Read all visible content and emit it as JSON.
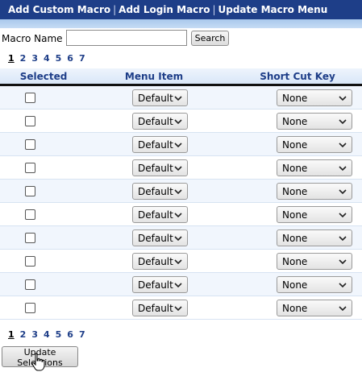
{
  "nav": {
    "items": [
      "Add Custom Macro",
      "Add Login Macro",
      "Update Macro Menu"
    ]
  },
  "search": {
    "label": "Macro Name",
    "value": "",
    "button_label": "Search"
  },
  "pager": {
    "pages": [
      "1",
      "2",
      "3",
      "4",
      "5",
      "6",
      "7"
    ],
    "current": "1"
  },
  "grid": {
    "headers": [
      "Selected",
      "Menu Item",
      "Short Cut Key"
    ],
    "rows": [
      {
        "selected": false,
        "menu_item": "Default",
        "short_cut": "None"
      },
      {
        "selected": false,
        "menu_item": "Default",
        "short_cut": "None"
      },
      {
        "selected": false,
        "menu_item": "Default",
        "short_cut": "None"
      },
      {
        "selected": false,
        "menu_item": "Default",
        "short_cut": "None"
      },
      {
        "selected": false,
        "menu_item": "Default",
        "short_cut": "None"
      },
      {
        "selected": false,
        "menu_item": "Default",
        "short_cut": "None"
      },
      {
        "selected": false,
        "menu_item": "Default",
        "short_cut": "None"
      },
      {
        "selected": false,
        "menu_item": "Default",
        "short_cut": "None"
      },
      {
        "selected": false,
        "menu_item": "Default",
        "short_cut": "None"
      },
      {
        "selected": false,
        "menu_item": "Default",
        "short_cut": "None"
      }
    ]
  },
  "footer": {
    "update_label": "Update Selections"
  },
  "colors": {
    "nav_bg": "#1e3e88",
    "link": "#1e3e88",
    "row_alt": "#f1f6fd"
  }
}
